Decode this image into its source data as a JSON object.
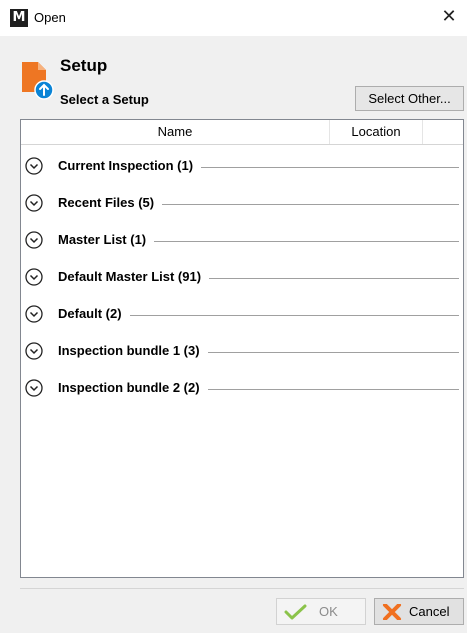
{
  "window": {
    "title": "Open",
    "app_icon_letter": "M",
    "close_glyph": "✕"
  },
  "header": {
    "title": "Setup",
    "subtitle": "Select a Setup",
    "select_other_label": "Select Other..."
  },
  "list": {
    "columns": [
      "Name",
      "Location",
      ""
    ],
    "groups": [
      {
        "label": "Current Inspection (1)"
      },
      {
        "label": "Recent Files (5)"
      },
      {
        "label": "Master List (1)"
      },
      {
        "label": "Default Master List (91)"
      },
      {
        "label": "Default (2)"
      },
      {
        "label": "Inspection bundle 1 (3)"
      },
      {
        "label": "Inspection bundle 2 (2)"
      }
    ]
  },
  "footer": {
    "ok_label": "OK",
    "cancel_label": "Cancel"
  },
  "colors": {
    "setup_icon": "#ee7623",
    "setup_badge": "#0a84d6",
    "ok_check": "#8bc34a",
    "cancel_x": "#f07020"
  },
  "icons": {
    "app": "app-logo-icon",
    "close": "close-icon",
    "setup": "setup-file-icon",
    "chevron": "chevron-down-circle-icon",
    "ok": "checkmark-icon",
    "cancel": "x-icon"
  }
}
